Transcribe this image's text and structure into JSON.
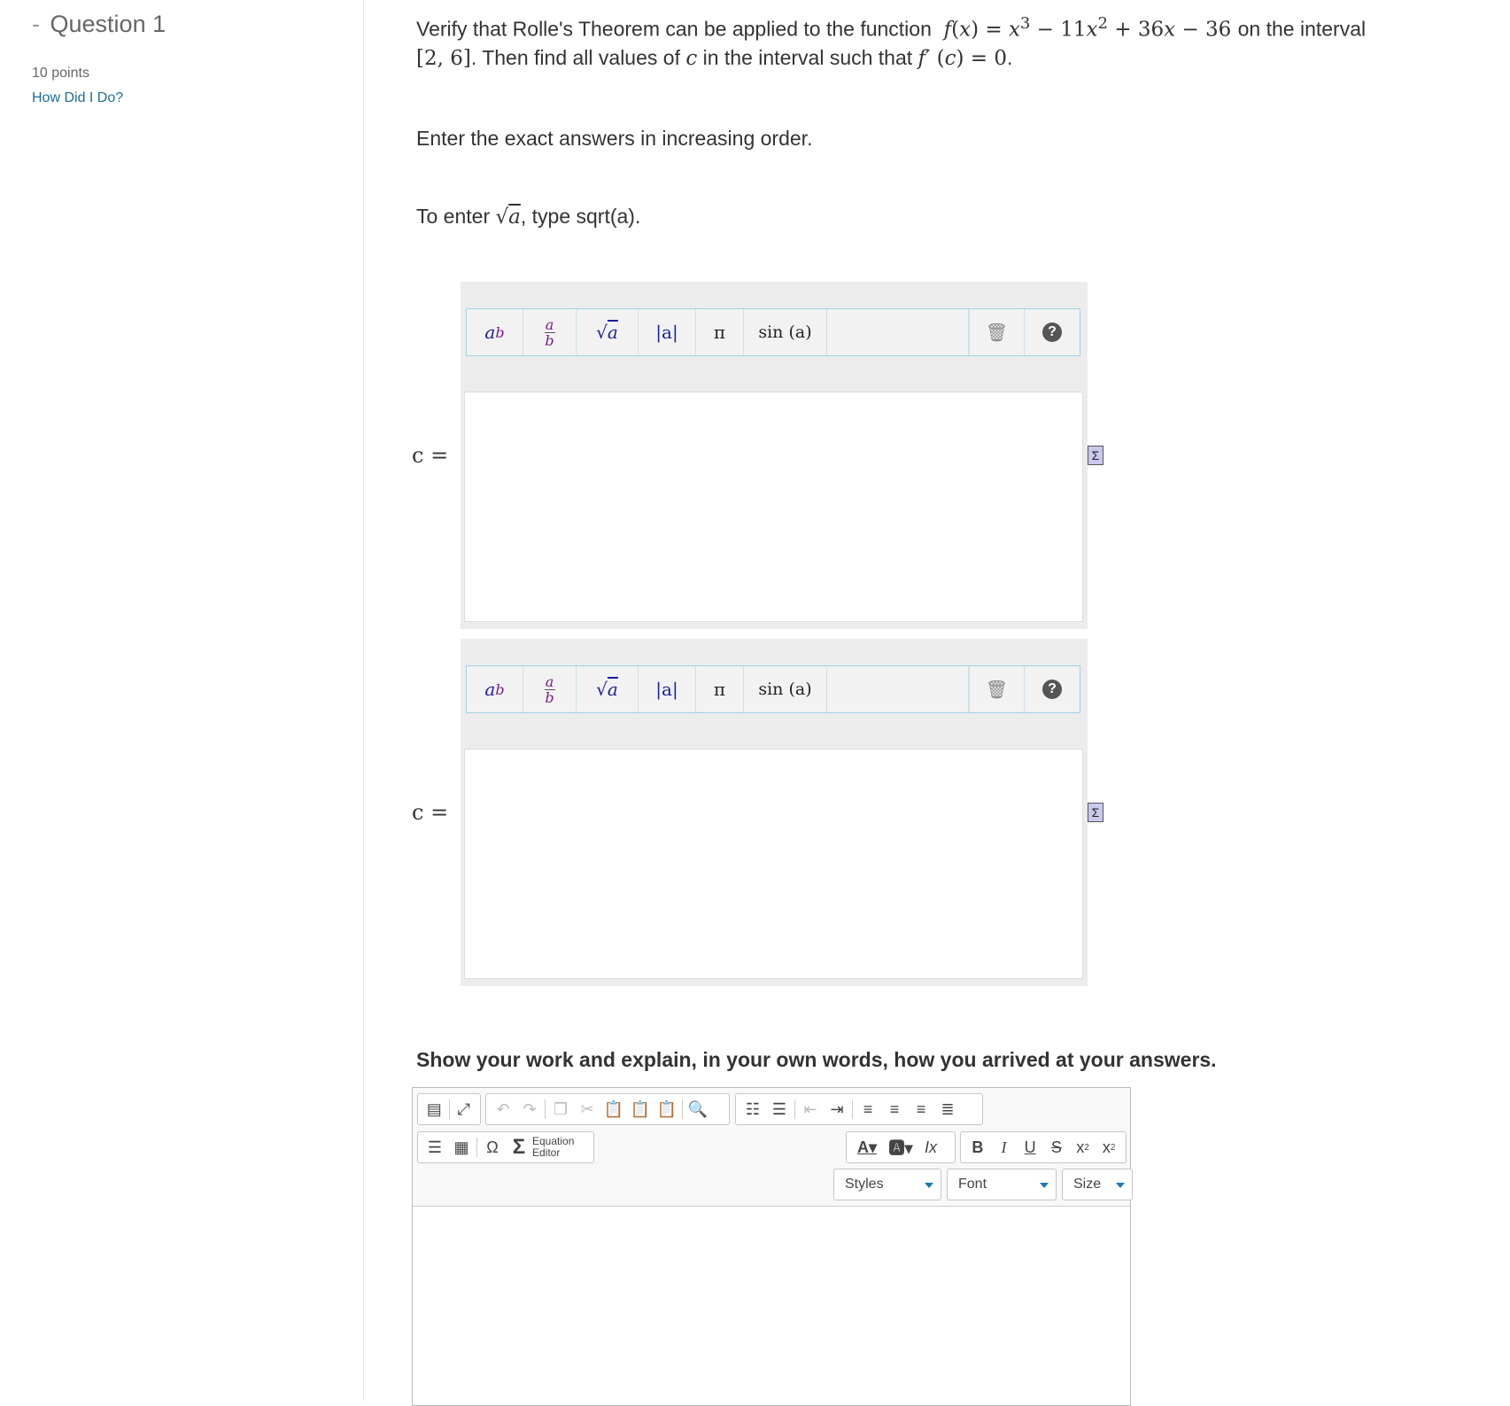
{
  "sidebar": {
    "dash": "-",
    "question_title": "Question 1",
    "points": "10 points",
    "how_did_i_do": "How Did I Do?"
  },
  "question": {
    "line1_prefix": "Verify that Rolle's Theorem can be applied to the function",
    "line1_suffix": "on the interval",
    "line2_mid": ". Then find all values of",
    "line2_mid2": "in the interval such that",
    "instruction1": "Enter the exact answers in increasing order.",
    "instruction2_prefix": "To enter",
    "instruction2_suffix": ", type sqrt(a).",
    "work_prompt": "Show your work and explain, in your own words, how you arrived at your answers."
  },
  "answers": [
    {
      "label": "c ="
    },
    {
      "label": "c ="
    }
  ],
  "math_toolbar": {
    "power": "power-button",
    "fraction": "fraction-button",
    "sqrt": "sqrt-button",
    "abs": "|a|",
    "pi": "π",
    "sin": "sin (a)"
  },
  "rte": {
    "equation_editor_line1": "Equation",
    "equation_editor_line2": "Editor",
    "styles": "Styles",
    "font": "Font",
    "size": "Size"
  }
}
